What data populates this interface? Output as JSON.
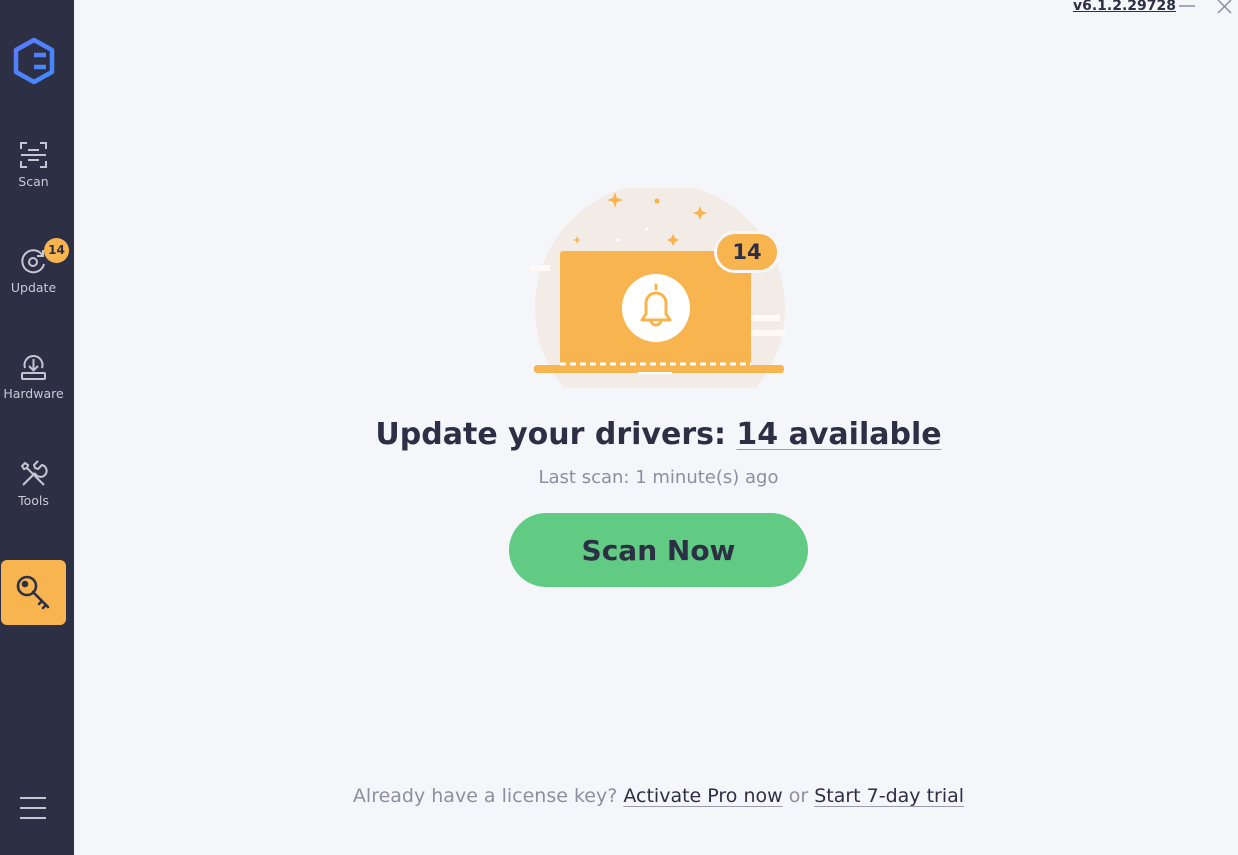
{
  "window": {
    "version": "v6.1.2.29728",
    "minimize_icon": "minimize-icon",
    "close_icon": "close-icon"
  },
  "sidebar": {
    "logo_icon": "app-logo-icon",
    "items": [
      {
        "label": "Scan",
        "icon": "scan-icon"
      },
      {
        "label": "Update",
        "icon": "update-icon",
        "badge": "14"
      },
      {
        "label": "Hardware",
        "icon": "hardware-icon"
      },
      {
        "label": "Tools",
        "icon": "tools-icon"
      }
    ],
    "key_icon": "key-icon",
    "menu_icon": "hamburger-menu-icon"
  },
  "main": {
    "count_badge": "14",
    "headline_prefix": "Update your drivers: ",
    "headline_count": "14 available",
    "last_scan": "Last scan: 1 minute(s) ago",
    "scan_button": "Scan Now"
  },
  "footer": {
    "prompt": "Already have a license key?",
    "activate_link": "Activate Pro now",
    "or": "or",
    "trial_link": "Start 7-day trial"
  },
  "colors": {
    "sidebar": "#2d2f45",
    "background": "#f5f6fa",
    "accent_orange": "#f8b44f",
    "accent_green": "#61cb84",
    "text_dark": "#2d2f45",
    "text_muted": "#8d8f9e"
  }
}
